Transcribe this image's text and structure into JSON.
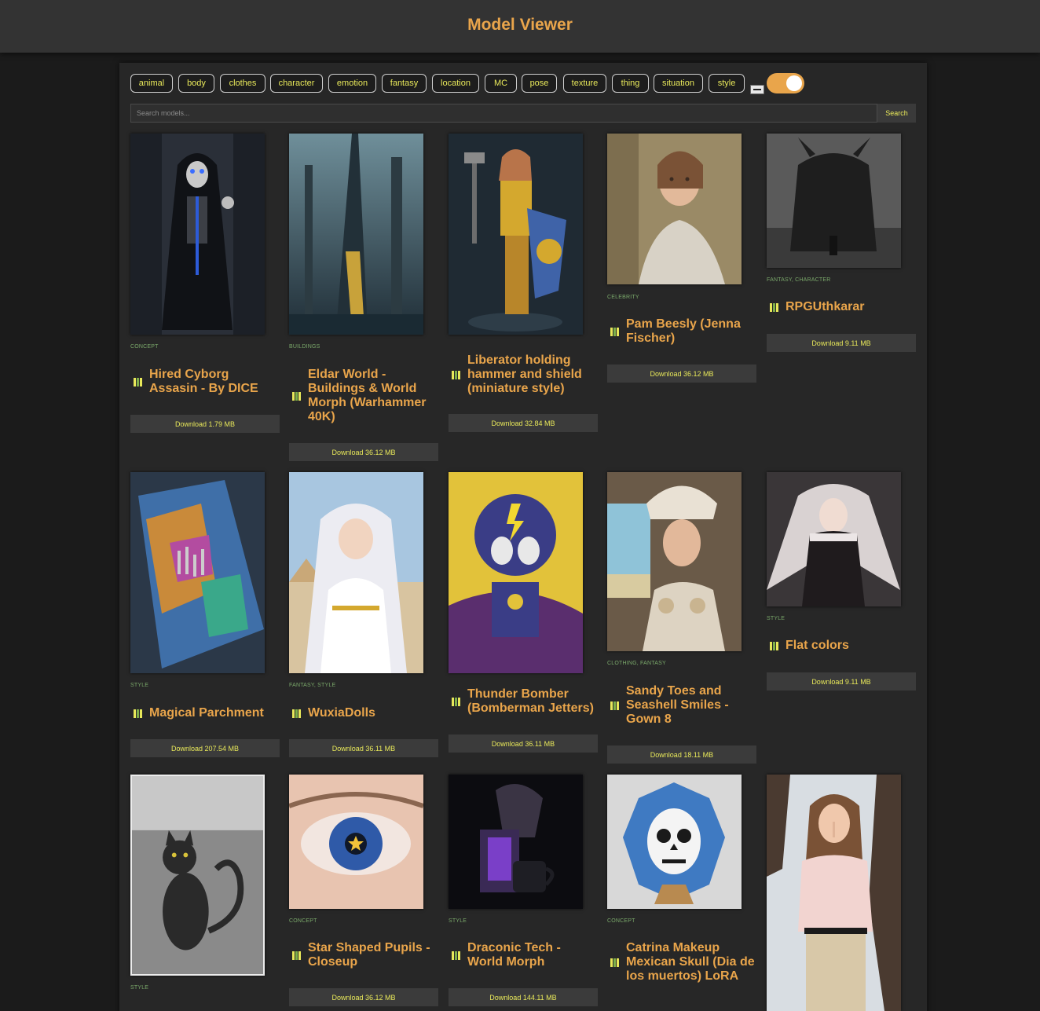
{
  "header": {
    "title": "Model Viewer"
  },
  "tags": [
    "animal",
    "body",
    "clothes",
    "character",
    "emotion",
    "fantasy",
    "location",
    "MC",
    "pose",
    "texture",
    "thing",
    "situation",
    "style"
  ],
  "search": {
    "placeholder": "Search models...",
    "button_label": "Search"
  },
  "toggle": {
    "state": "on",
    "color": "#e9a54b"
  },
  "colors": {
    "accent": "#e9a54b",
    "tag_text": "#e8e85a",
    "category_text": "#7aa86a",
    "panel": "#272727"
  },
  "cards": [
    {
      "categories": "CONCEPT",
      "title": "Hired Cyborg Assasin - By DICE",
      "download": "Download 1.79 MB",
      "image": "hooded-skeleton-cyborg"
    },
    {
      "categories": "BUILDINGS",
      "title": "Eldar World - Buildings & World Morph (Warhammer 40K)",
      "download": "Download 36.12 MB",
      "image": "sci-fi-spire-city"
    },
    {
      "categories": "",
      "title": "Liberator holding hammer and shield (miniature style)",
      "download": "Download 32.84 MB",
      "image": "golden-armored-warrior-miniature"
    },
    {
      "categories": "CELEBRITY",
      "title": "Pam Beesly (Jenna Fischer)",
      "download": "Download 36.12 MB",
      "image": "woman-portrait"
    },
    {
      "categories": "FANTASY, CHARACTER",
      "title": "RPGUthkarar",
      "download": "Download 9.11 MB",
      "image": "dark-horned-monster"
    },
    {
      "categories": "STYLE",
      "title": "Magical Parchment",
      "download": "Download 207.54 MB",
      "image": "colorful-map-city"
    },
    {
      "categories": "FANTASY, STYLE",
      "title": "WuxiaDolls",
      "download": "Download 36.11 MB",
      "image": "anime-girl-pyramids"
    },
    {
      "categories": "",
      "title": "Thunder Bomber (Bomberman Jetters)",
      "download": "Download 36.11 MB",
      "image": "cartoon-bomber-character"
    },
    {
      "categories": "CLOTHING, FANTASY",
      "title": "Sandy Toes and Seashell Smiles - Gown 8",
      "download": "Download 18.11 MB",
      "image": "seashell-gown-woman"
    },
    {
      "categories": "STYLE",
      "title": "Flat colors",
      "download": "Download 9.11 MB",
      "image": "flat-anime-girl"
    },
    {
      "categories": "STYLE",
      "title": "",
      "download": "",
      "image": "ink-cat-card"
    },
    {
      "categories": "CONCEPT",
      "title": "Star Shaped Pupils - Closeup",
      "download": "Download 36.12 MB",
      "image": "star-pupil-eye"
    },
    {
      "categories": "STYLE",
      "title": "Draconic Tech - World Morph",
      "download": "Download 144.11 MB",
      "image": "dragon-coffee-machine"
    },
    {
      "categories": "CONCEPT",
      "title": "Catrina Makeup Mexican Skull (Dia de los muertos) LoRA",
      "download": "",
      "image": "sugar-skull-origami-mask"
    },
    {
      "categories": "",
      "title": "",
      "download": "",
      "image": "woman-eiffel-tower"
    }
  ]
}
